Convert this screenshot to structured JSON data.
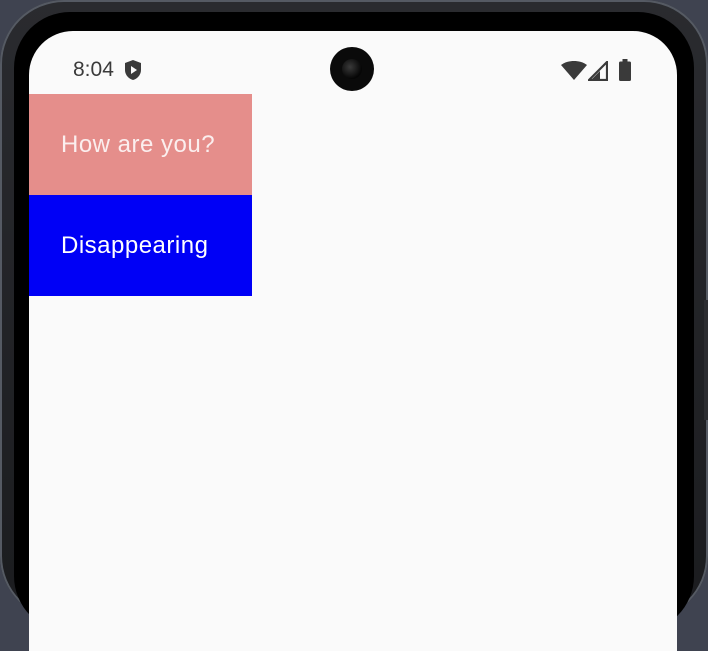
{
  "status_bar": {
    "time": "8:04",
    "icons": [
      "shield-play-icon",
      "wifi-icon",
      "cell-signal-icon",
      "battery-icon"
    ]
  },
  "list": {
    "items": [
      {
        "label": "How are you?",
        "color": "#e58e8b"
      },
      {
        "label": "Disappearing",
        "color": "#0000f6"
      }
    ]
  },
  "colors": {
    "screen_background": "#fafafa",
    "device_background": "#3f4350"
  }
}
